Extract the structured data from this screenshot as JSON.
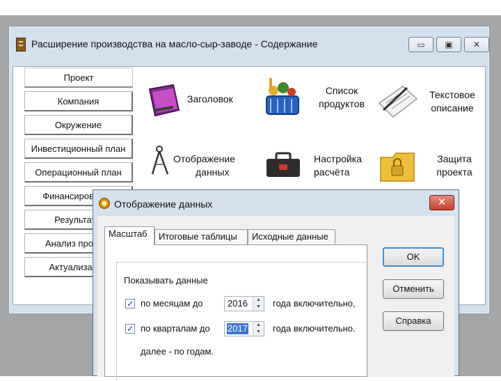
{
  "window": {
    "title": "Расширение производства на масло-сыр-заводе - Содержание",
    "controls": [
      "minimize",
      "maximize",
      "close"
    ]
  },
  "nav": [
    {
      "label": "Проект"
    },
    {
      "label": "Компания"
    },
    {
      "label": "Окружение"
    },
    {
      "label": "Инвестиционный план"
    },
    {
      "label": "Операционный план"
    },
    {
      "label": "Финансирование"
    },
    {
      "label": "Результаты"
    },
    {
      "label": "Анализ проекта"
    },
    {
      "label": "Актуализация"
    }
  ],
  "tiles": {
    "header": {
      "label": "Заголовок",
      "icon": "folder-icon"
    },
    "products": {
      "line1": "Список",
      "line2": "продуктов",
      "icon": "basket-icon"
    },
    "text": {
      "line1": "Текстовое",
      "line2": "описание",
      "icon": "document-pen-icon"
    },
    "display": {
      "line1": "Отображение",
      "line2": "данных",
      "icon": "compass-icon"
    },
    "settings": {
      "line1": "Настройка",
      "line2": "расчёта",
      "icon": "toolbox-icon"
    },
    "protect": {
      "line1": "Защита",
      "line2": "проекта",
      "icon": "lock-folder-icon"
    }
  },
  "dialog": {
    "title": "Отображение данных",
    "tabs": [
      "Масштаб",
      "Итоговые таблицы",
      "Исходные данные"
    ],
    "selected_tab": "Масштаб",
    "group_label": "Показывать данные",
    "rows": [
      {
        "checked": true,
        "label": "по месяцам до",
        "value": "2016",
        "suffix": "года включительно,"
      },
      {
        "checked": true,
        "label": "по кварталам до",
        "value": "2017",
        "suffix": "года включительно."
      }
    ],
    "footer_text": "далее - по годам.",
    "buttons": {
      "ok": "OK",
      "cancel": "Отменить",
      "help": "Справка"
    }
  }
}
